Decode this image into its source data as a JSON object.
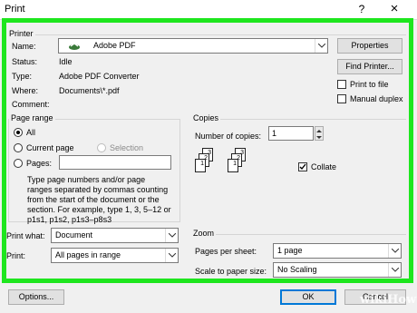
{
  "window": {
    "title": "Print",
    "help_glyph": "?",
    "close_glyph": "×"
  },
  "printer": {
    "group_label": "Printer",
    "name_label": "Name:",
    "name_value": "Adobe PDF",
    "status_label": "Status:",
    "status_value": "Idle",
    "type_label": "Type:",
    "type_value": "Adobe PDF Converter",
    "where_label": "Where:",
    "where_value": "Documents\\*.pdf",
    "comment_label": "Comment:",
    "comment_value": "",
    "properties_button": "Properties",
    "find_printer_button": "Find Printer...",
    "print_to_file_label": "Print to file",
    "print_to_file_checked": false,
    "manual_duplex_label": "Manual duplex",
    "manual_duplex_checked": false
  },
  "page_range": {
    "group_label": "Page range",
    "all_label": "All",
    "current_page_label": "Current page",
    "selection_label": "Selection",
    "pages_label": "Pages:",
    "pages_value": "",
    "selected": "all",
    "help_line1": "Type page numbers and/or page",
    "help_line2": "ranges separated by commas counting",
    "help_line3": "from the start of the document or the",
    "help_line4": "section. For example, type 1, 3, 5–12 or",
    "help_line5": "p1s1, p1s2, p1s3–p8s3"
  },
  "copies": {
    "group_label": "Copies",
    "number_label": "Number of copies:",
    "number_value": "1",
    "collate_label": "Collate",
    "collate_checked": true
  },
  "print_what": {
    "label": "Print what:",
    "value": "Document"
  },
  "print": {
    "label": "Print:",
    "value": "All pages in range"
  },
  "zoom": {
    "group_label": "Zoom",
    "pages_per_sheet_label": "Pages per sheet:",
    "pages_per_sheet_value": "1 page",
    "scale_label": "Scale to paper size:",
    "scale_value": "No Scaling"
  },
  "footer": {
    "options_button": "Options...",
    "ok_button": "OK",
    "cancel_button": "Cancel"
  },
  "watermark": "wikiHow",
  "colors": {
    "highlight_frame": "#1ee61e",
    "accent": "#0078d7"
  }
}
